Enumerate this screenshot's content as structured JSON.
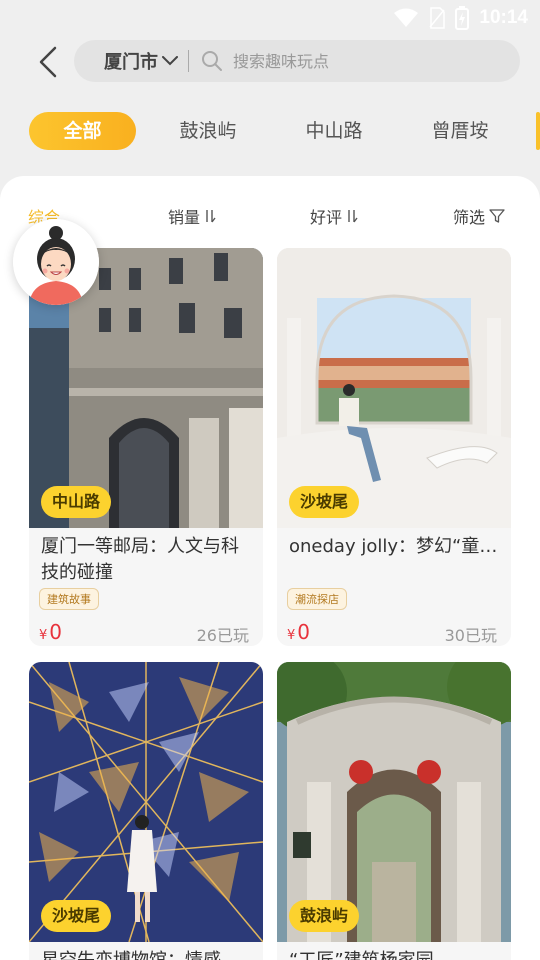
{
  "status": {
    "time": "10:14"
  },
  "header": {
    "city": "厦门市",
    "search_placeholder": "搜索趣味玩点"
  },
  "area_tabs": [
    {
      "label": "全部",
      "active": true
    },
    {
      "label": "鼓浪屿",
      "active": false
    },
    {
      "label": "中山路",
      "active": false
    },
    {
      "label": "曾厝垵",
      "active": false
    }
  ],
  "sort_bar": {
    "items": [
      {
        "label": "综合",
        "active": true
      },
      {
        "label": "销量",
        "active": false
      },
      {
        "label": "好评",
        "active": false
      },
      {
        "label": "筛选",
        "active": false
      }
    ]
  },
  "cards": [
    {
      "area": "中山路",
      "title": "厦门一等邮局：人文与科技的碰撞",
      "tag": "建筑故事",
      "price_symbol": "¥",
      "price": "0",
      "played": "26已玩"
    },
    {
      "area": "沙坡尾",
      "title": "oneday jolly：梦幻“童…",
      "tag": "潮流探店",
      "price_symbol": "¥",
      "price": "0",
      "played": "30已玩"
    },
    {
      "area": "沙坡尾",
      "title": "星空失恋博物馆：情感",
      "tag": "",
      "price_symbol": "",
      "price": "",
      "played": ""
    },
    {
      "area": "鼓浪屿",
      "title": "“工匠”建筑杨家园",
      "tag": "",
      "price_symbol": "",
      "price": "",
      "played": ""
    }
  ],
  "colors": {
    "accent": "#f9b01f",
    "badge": "#fcd22e",
    "price": "#e8323c"
  }
}
